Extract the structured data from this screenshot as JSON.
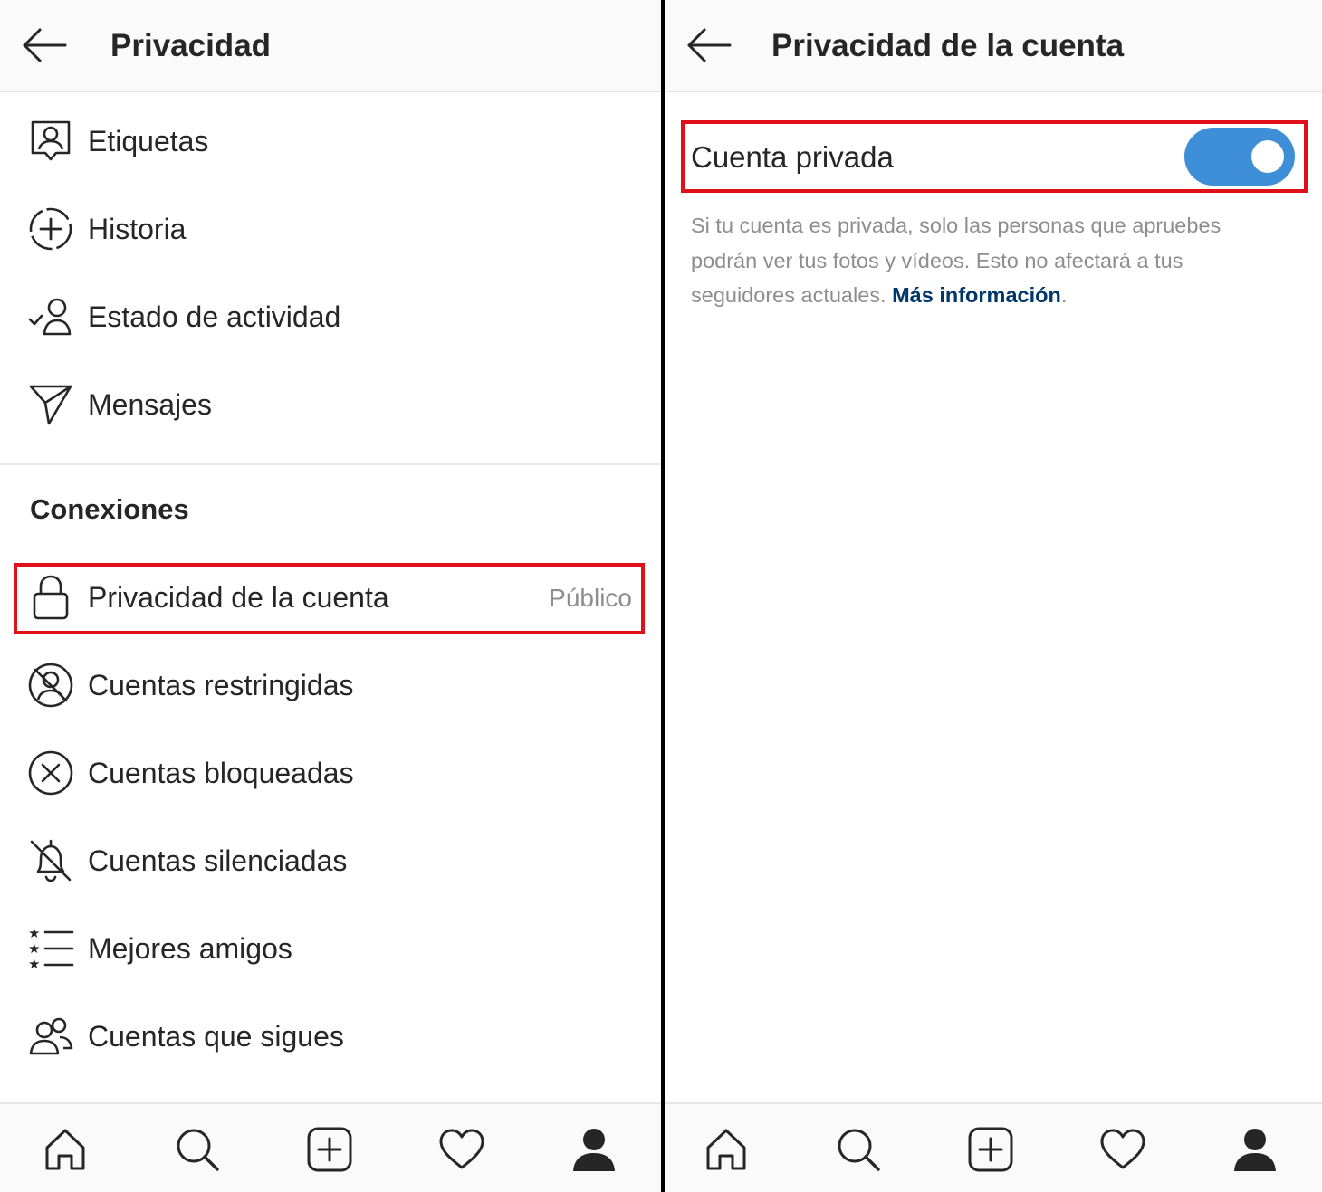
{
  "left_panel": {
    "title": "Privacidad",
    "items_top": [
      {
        "label": "Etiquetas",
        "icon": "tag-person-icon"
      },
      {
        "label": "Historia",
        "icon": "story-add-icon"
      },
      {
        "label": "Estado de actividad",
        "icon": "activity-status-icon"
      },
      {
        "label": "Mensajes",
        "icon": "paper-plane-icon"
      }
    ],
    "section_title": "Conexiones",
    "items_connections": [
      {
        "label": "Privacidad de la cuenta",
        "value": "Público",
        "icon": "lock-icon",
        "highlighted": true
      },
      {
        "label": "Cuentas restringidas",
        "icon": "restricted-icon"
      },
      {
        "label": "Cuentas bloqueadas",
        "icon": "blocked-icon"
      },
      {
        "label": "Cuentas silenciadas",
        "icon": "muted-bell-icon"
      },
      {
        "label": "Mejores amigos",
        "icon": "close-friends-list-icon"
      },
      {
        "label": "Cuentas que sigues",
        "icon": "following-users-icon"
      }
    ]
  },
  "right_panel": {
    "title": "Privacidad de la cuenta",
    "private_account": {
      "label": "Cuenta privada",
      "enabled": true,
      "highlighted": true
    },
    "description": "Si tu cuenta es privada, solo las personas que apruebes podrán ver tus fotos y vídeos. Esto no afectará a tus seguidores actuales.",
    "more_info_link": "Más información",
    "after_link": "."
  },
  "bottom_nav": [
    "home-icon",
    "search-icon",
    "new-post-icon",
    "activity-heart-icon",
    "profile-icon"
  ],
  "colors": {
    "highlight": "#e0101a",
    "toggle_on": "#3f8fd8",
    "link": "#00376b",
    "secondary_text": "#8e8e8e",
    "header_bg": "#fafafa"
  }
}
